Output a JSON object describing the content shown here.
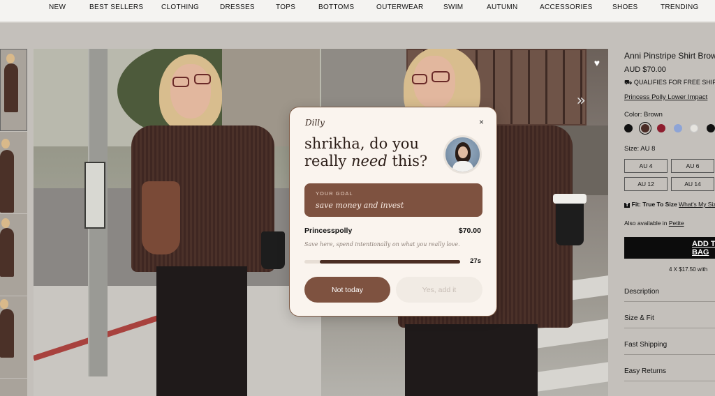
{
  "nav": {
    "items": [
      "NEW",
      "BEST SELLERS",
      "CLOTHING",
      "DRESSES",
      "TOPS",
      "BOTTOMS",
      "OUTERWEAR",
      "SWIM",
      "AUTUMN",
      "ACCESSORIES",
      "SHOES",
      "TRENDING"
    ]
  },
  "product": {
    "title": "Anni Pinstripe Shirt Brown",
    "price": "AUD $70.00",
    "shipping": "QUALIFIES FOR FREE SHIPPING",
    "impact_link": "Princess Polly Lower Impact",
    "color_label": "Color:  Brown",
    "swatches": [
      "#111111",
      "#4a2b25",
      "#8e1d2e",
      "#8ea4d6",
      "#e6e4df",
      "#111111"
    ],
    "size_label": "Size: AU 8",
    "sizes": [
      "AU 4",
      "AU 6",
      "AU 12",
      "AU 14"
    ],
    "fit_prefix": "Fit: True To Size",
    "fit_link": "What's My Size",
    "also_available_prefix": "Also available in",
    "also_available_link": "Petite",
    "add_button": "ADD TO BAG",
    "afterpay": "4 X $17.50 with",
    "accordions": [
      "Description",
      "Size & Fit",
      "Fast Shipping",
      "Easy Returns"
    ]
  },
  "modal": {
    "brand": "Dilly",
    "close": "×",
    "headline_line1": "shrikha, do you",
    "headline_pre": "really ",
    "headline_em": "need",
    "headline_post": " this?",
    "goal_label": "YOUR GOAL",
    "goal_value": "save money and invest",
    "merchant": "Princesspolly",
    "amount": "$70.00",
    "tagline": "Save here, spend intentionally on what you really love.",
    "timer_fraction_remaining": 0.9,
    "timer_text": "27s",
    "not_today": "Not today",
    "yes_add": "Yes, add it"
  },
  "colors": {
    "accent_brown": "#7e5240",
    "modal_bg": "#faf4ee"
  },
  "icons": {
    "heart": "♥",
    "chevron": "»",
    "truck": "⛟",
    "tshirt": "T"
  }
}
